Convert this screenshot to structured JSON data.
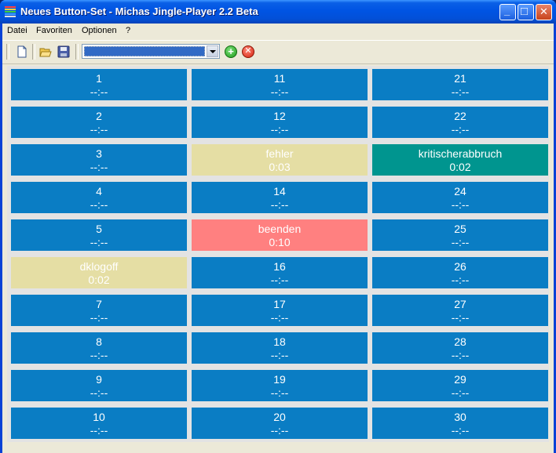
{
  "window": {
    "title": "Neues Button-Set - Michas Jingle-Player 2.2 Beta",
    "minimize_glyph": "_",
    "maximize_glyph": "□",
    "close_glyph": "✕"
  },
  "menu": [
    "Datei",
    "Favoriten",
    "Optionen",
    "?"
  ],
  "toolbar": {
    "new_icon": "document-icon",
    "open_icon": "folder-icon",
    "save_icon": "floppy-disk-icon",
    "add_glyph": "+",
    "delete_glyph": "✕",
    "combo_value": ""
  },
  "colors": {
    "empty": "#0a7dc4",
    "yellow": "#e5dea4",
    "teal": "#00958f",
    "red": "#ff8080"
  },
  "buttons": [
    {
      "label": "1",
      "time": "--:--",
      "color": "empty"
    },
    {
      "label": "2",
      "time": "--:--",
      "color": "empty"
    },
    {
      "label": "3",
      "time": "--:--",
      "color": "empty"
    },
    {
      "label": "4",
      "time": "--:--",
      "color": "empty"
    },
    {
      "label": "5",
      "time": "--:--",
      "color": "empty"
    },
    {
      "label": "dklogoff",
      "time": "0:02",
      "color": "yellow"
    },
    {
      "label": "7",
      "time": "--:--",
      "color": "empty"
    },
    {
      "label": "8",
      "time": "--:--",
      "color": "empty"
    },
    {
      "label": "9",
      "time": "--:--",
      "color": "empty"
    },
    {
      "label": "10",
      "time": "--:--",
      "color": "empty"
    },
    {
      "label": "11",
      "time": "--:--",
      "color": "empty"
    },
    {
      "label": "12",
      "time": "--:--",
      "color": "empty"
    },
    {
      "label": "fehler",
      "time": "0:03",
      "color": "yellow"
    },
    {
      "label": "14",
      "time": "--:--",
      "color": "empty"
    },
    {
      "label": "beenden",
      "time": "0:10",
      "color": "red"
    },
    {
      "label": "16",
      "time": "--:--",
      "color": "empty"
    },
    {
      "label": "17",
      "time": "--:--",
      "color": "empty"
    },
    {
      "label": "18",
      "time": "--:--",
      "color": "empty"
    },
    {
      "label": "19",
      "time": "--:--",
      "color": "empty"
    },
    {
      "label": "20",
      "time": "--:--",
      "color": "empty"
    },
    {
      "label": "21",
      "time": "--:--",
      "color": "empty"
    },
    {
      "label": "22",
      "time": "--:--",
      "color": "empty"
    },
    {
      "label": "kritischerabbruch",
      "time": "0:02",
      "color": "teal"
    },
    {
      "label": "24",
      "time": "--:--",
      "color": "empty"
    },
    {
      "label": "25",
      "time": "--:--",
      "color": "empty"
    },
    {
      "label": "26",
      "time": "--:--",
      "color": "empty"
    },
    {
      "label": "27",
      "time": "--:--",
      "color": "empty"
    },
    {
      "label": "28",
      "time": "--:--",
      "color": "empty"
    },
    {
      "label": "29",
      "time": "--:--",
      "color": "empty"
    },
    {
      "label": "30",
      "time": "--:--",
      "color": "empty"
    }
  ]
}
